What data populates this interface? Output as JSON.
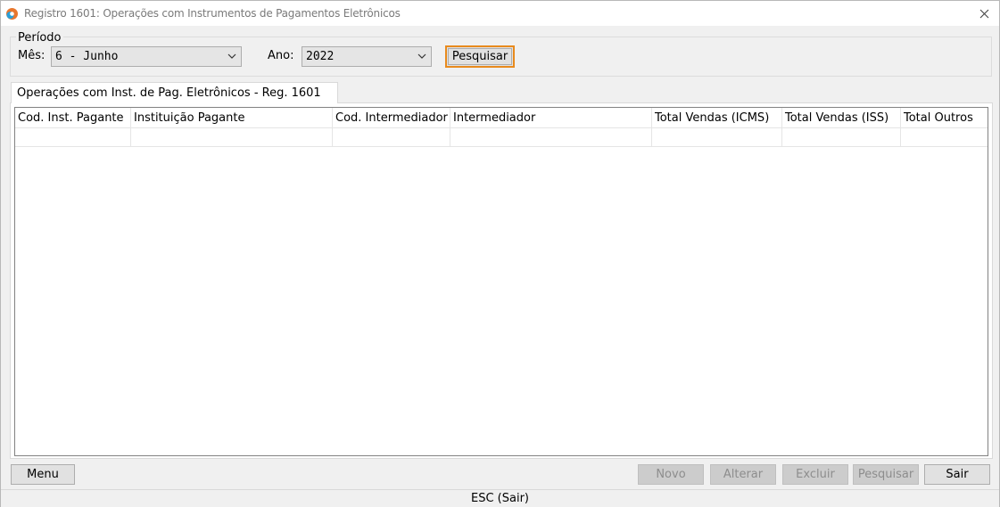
{
  "window": {
    "title": "Registro 1601: Operações com Instrumentos de Pagamentos Eletrônicos",
    "close_icon": "close-icon",
    "app_icon": "app-logo-icon"
  },
  "periodo": {
    "legend": "Período",
    "mes_label": "Mês:",
    "mes_value": "6 - Junho",
    "ano_label": "Ano:",
    "ano_value": "2022",
    "search_label": "Pesquisar"
  },
  "tab": {
    "label": "Operações com Inst. de Pag. Eletrônicos - Reg. 1601"
  },
  "grid": {
    "columns": [
      "Cod. Inst. Pagante",
      "Instituição Pagante",
      "Cod. Intermediador",
      "Intermediador",
      "Total Vendas (ICMS)",
      "Total Vendas (ISS)",
      "Total Outros"
    ],
    "rows": []
  },
  "buttons": {
    "menu": "Menu",
    "novo": "Novo",
    "alterar": "Alterar",
    "excluir": "Excluir",
    "pesquisar": "Pesquisar",
    "sair": "Sair"
  },
  "status": {
    "text": "ESC (Sair)"
  },
  "colors": {
    "focus_accent": "#e88a1d",
    "window_bg": "#f0f0f0"
  }
}
